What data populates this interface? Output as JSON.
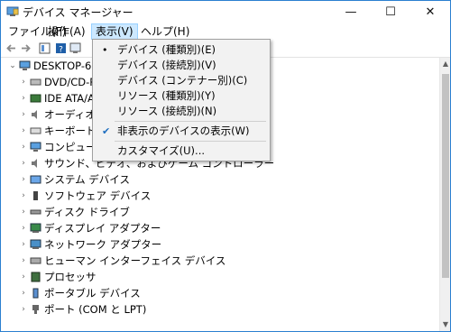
{
  "window": {
    "title": "デバイス マネージャー",
    "controls": [
      "—",
      "☐",
      "✕"
    ]
  },
  "menubar": {
    "items": [
      "ファイル(F)",
      "操作(A)",
      "表示(V)",
      "ヘルプ(H)"
    ],
    "active_index": 2
  },
  "dropdown": {
    "items": [
      {
        "label": "デバイス (種類別)(E)",
        "mark": "•"
      },
      {
        "label": "デバイス (接続別)(V)",
        "mark": ""
      },
      {
        "label": "デバイス (コンテナー別)(C)",
        "mark": ""
      },
      {
        "label": "リソース (種類別)(Y)",
        "mark": ""
      },
      {
        "label": "リソース (接続別)(N)",
        "mark": ""
      },
      {
        "label": "非表示のデバイスの表示(W)",
        "mark": "✔"
      },
      {
        "label": "カスタマイズ(U)...",
        "mark": ""
      }
    ]
  },
  "tree": {
    "root": "DESKTOP-671F",
    "items": [
      "DVD/CD-RO",
      "IDE ATA/ATA",
      "オーディオの入",
      "キーボード",
      "コンピューター",
      "サウンド、ビデオ、およびゲーム コントローラー",
      "システム デバイス",
      "ソフトウェア デバイス",
      "ディスク ドライブ",
      "ディスプレイ アダプター",
      "ネットワーク アダプター",
      "ヒューマン インターフェイス デバイス",
      "プロセッサ",
      "ポータブル デバイス",
      "ポート (COM と LPT)"
    ]
  },
  "colors": {
    "accent": "#0078d7",
    "menu_active_bg": "#cce8ff",
    "dropdown_bg": "#f2f2f2"
  }
}
